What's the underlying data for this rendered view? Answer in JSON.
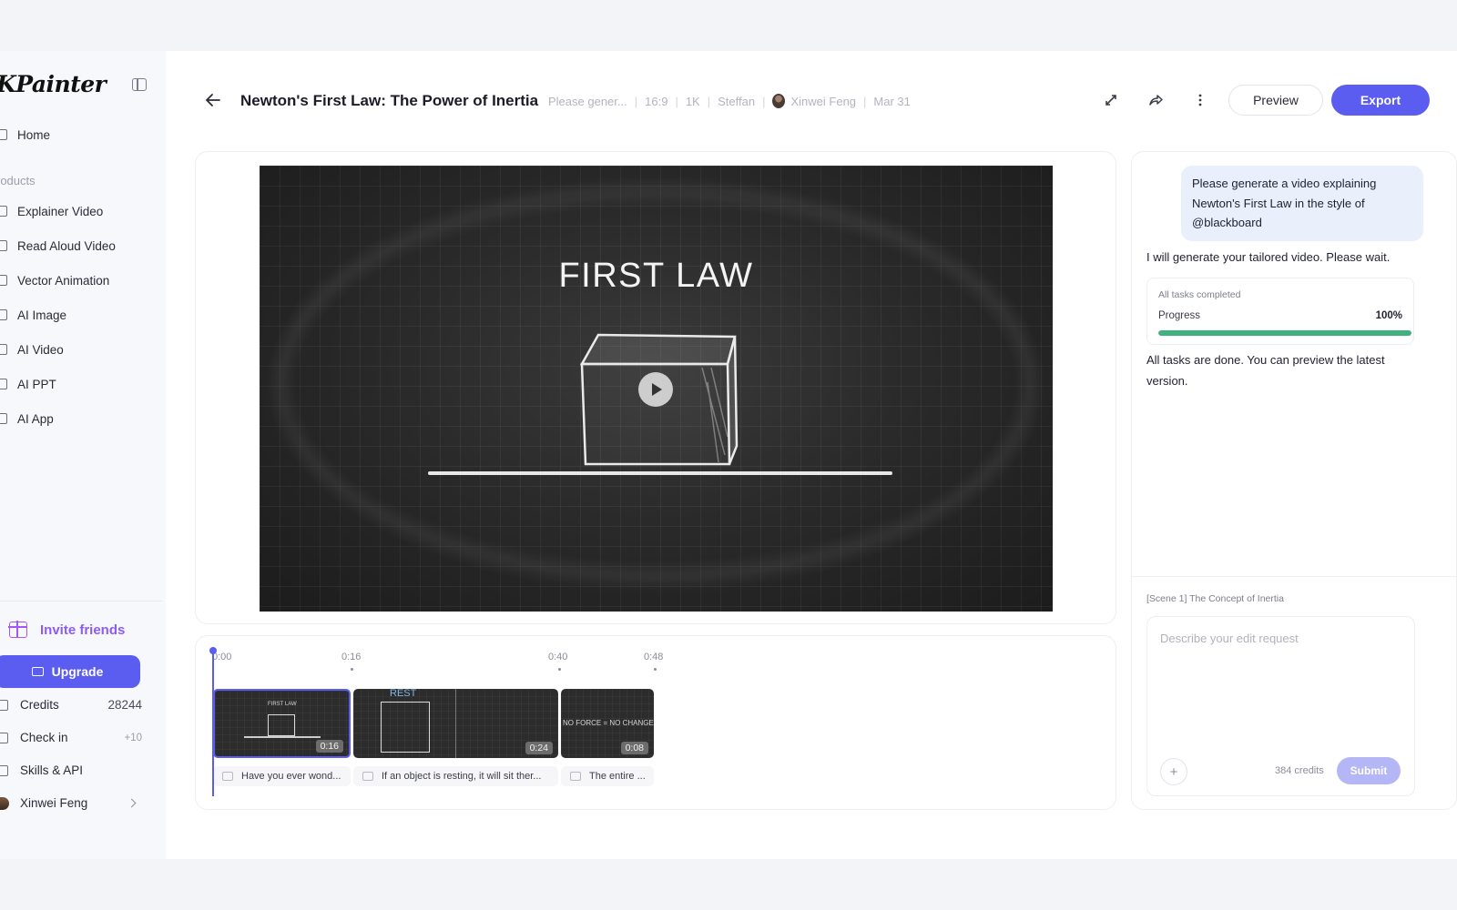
{
  "app": {
    "logo": "KPainter"
  },
  "sidebar": {
    "nav": [
      {
        "label": "Home",
        "icon": "home-icon"
      },
      {
        "label": "Explainer Video",
        "icon": "explainer-video-icon"
      },
      {
        "label": "Read Aloud Video",
        "icon": "read-aloud-icon"
      },
      {
        "label": "Vector Animation",
        "icon": "vector-animation-icon"
      },
      {
        "label": "AI Image",
        "icon": "image-icon"
      },
      {
        "label": "AI Video",
        "icon": "video-icon"
      },
      {
        "label": "AI PPT",
        "icon": "ppt-icon"
      },
      {
        "label": "AI App",
        "icon": "app-icon"
      }
    ],
    "section_label": "roducts",
    "invite_label": "Invite friends",
    "upgrade_label": "Upgrade",
    "credits_label": "Credits",
    "credits_value": "28244",
    "checkin_label": "Check in",
    "checkin_value": "+10",
    "skills_label": "Skills & API",
    "user_name": "Xinwei Feng"
  },
  "header": {
    "title": "Newton's First Law: The Power of Inertia",
    "meta": {
      "prompt": "Please gener...",
      "ratio": "16:9",
      "resolution": "1K",
      "voice": "Steffan",
      "author": "Xinwei Feng",
      "date": "Mar 31"
    },
    "preview_label": "Preview",
    "export_label": "Export"
  },
  "video": {
    "title": "FIRST LAW"
  },
  "timeline": {
    "ticks": [
      "0:00",
      "0:16",
      "0:40",
      "0:48"
    ],
    "clips": [
      {
        "duration": "0:16",
        "thumb_text": "FIRST LAW",
        "caption": "Have you ever wond..."
      },
      {
        "duration": "0:24",
        "thumb_text": "REST",
        "caption": "If an object is resting, it will sit ther..."
      },
      {
        "duration": "0:08",
        "thumb_text": "NO FORCE = NO CHANGE",
        "caption": "The entire ..."
      }
    ]
  },
  "chat": {
    "user_message": "Please generate a video explaining Newton's First Law in the style of @blackboard",
    "bot_message": "I will generate your tailored video. Please wait.",
    "progress": {
      "caption": "All tasks completed",
      "label": "Progress",
      "value": 100,
      "value_text": "100%"
    },
    "done_message": "All tasks are done. You can preview the latest version.",
    "scene_label": "[Scene 1] The Concept of Inertia",
    "edit_placeholder": "Describe your edit request",
    "credits_cost": "384 credits",
    "submit_label": "Submit"
  },
  "colors": {
    "accent": "#5b5cf0",
    "progress": "#3fb27f",
    "invite": "#8b5cf6"
  }
}
